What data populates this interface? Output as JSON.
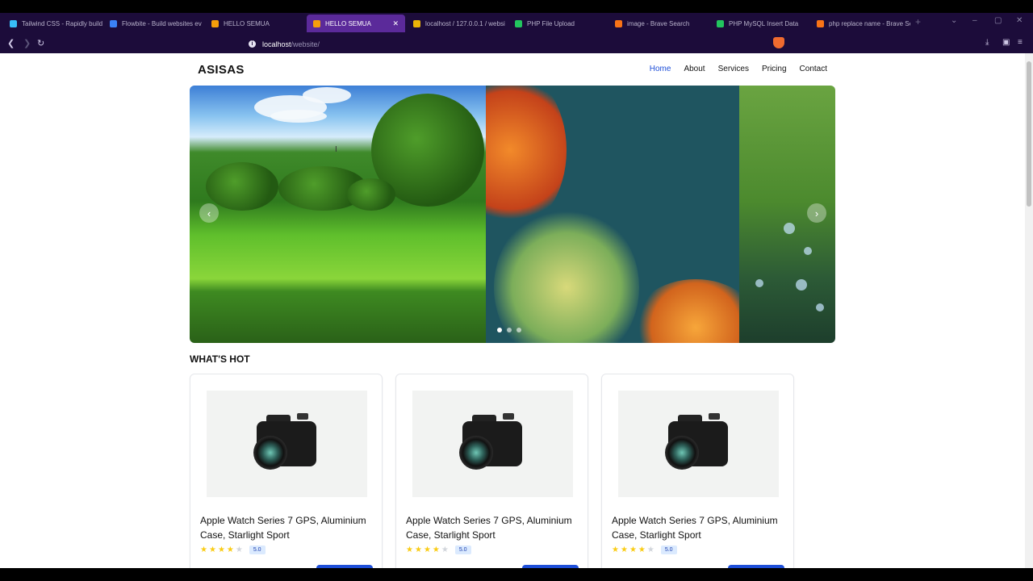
{
  "browser": {
    "tabs": [
      {
        "label": "Tailwind CSS - Rapidly build",
        "color": "#38bdf8"
      },
      {
        "label": "Flowbite - Build websites ev",
        "color": "#3b82f6"
      },
      {
        "label": "HELLO SEMUA",
        "color": "#f59e0b"
      },
      {
        "label": "HELLO SEMUA",
        "color": "#f59e0b"
      },
      {
        "label": "localhost / 127.0.0.1 / websi",
        "color": "#eab308"
      },
      {
        "label": "PHP File Upload",
        "color": "#22c55e"
      },
      {
        "label": "image - Brave Search",
        "color": "#f97316"
      },
      {
        "label": "PHP MySQL Insert Data",
        "color": "#22c55e"
      },
      {
        "label": "php replace name - Brave Se",
        "color": "#f97316"
      }
    ],
    "active_tab_index": 3,
    "url_host": "localhost",
    "url_path": "/website/"
  },
  "site": {
    "logo": "ASISAS",
    "menu": [
      "Home",
      "About",
      "Services",
      "Pricing",
      "Contact"
    ],
    "active_menu_index": 0
  },
  "carousel": {
    "prev_icon": "‹",
    "next_icon": "›",
    "slide_count": 3,
    "active_slide_index": 0
  },
  "section": {
    "title": "WHAT'S HOT"
  },
  "products": [
    {
      "title": "Apple Watch Series 7 GPS, Aluminium Case, Starlight Sport",
      "rating": 4,
      "rating_label": "5.0"
    },
    {
      "title": "Apple Watch Series 7 GPS, Aluminium Case, Starlight Sport",
      "rating": 4,
      "rating_label": "5.0"
    },
    {
      "title": "Apple Watch Series 7 GPS, Aluminium Case, Starlight Sport",
      "rating": 4,
      "rating_label": "5.0"
    }
  ],
  "colors": {
    "accent": "#1d4ed8",
    "browser_bg": "#1c0c3a",
    "active_tab": "#5b2a9a"
  }
}
